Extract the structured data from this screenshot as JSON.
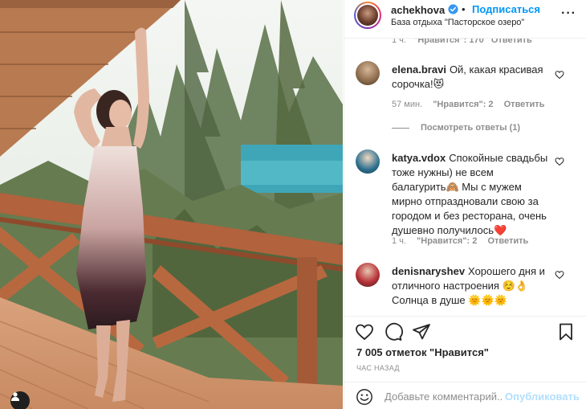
{
  "post": {
    "username": "achekhova",
    "follow_label": "Подписаться",
    "separator": "•",
    "location": "База отдыха \"Пасторское озеро\"",
    "more_glyph": "···"
  },
  "top_cut": {
    "time": "1 ч.",
    "likes": "\"Нравится\": 170",
    "reply": "Ответить"
  },
  "comments": [
    {
      "user": "elena.bravi",
      "text": "Ой, какая красивая сорочка!😻",
      "time": "57 мин.",
      "likes": "\"Нравится\": 2",
      "reply": "Ответить",
      "avatar_color": "#8a6a4a"
    },
    {
      "user": "katya.vdox",
      "text": "Спокойные свадьбы тоже нужны) не всем балагурить🙈 Мы с мужем мирно отпраздновали свою за городом и без ресторана, очень душевно получилось❤️",
      "time": "1 ч.",
      "likes": "\"Нравится\": 2",
      "reply": "Ответить",
      "avatar_color": "#2c6f8f"
    },
    {
      "user": "denisnaryshev",
      "text": "Хорошего дня и отличного настроения ☺️👌 Солнца в душе 🌞🌞🌞",
      "avatar_color": "#b8343a"
    }
  ],
  "view_replies": "Посмотреть ответы (1)",
  "likes_count": "7 005 отметок \"Нравится\"",
  "timestamp": "час назад",
  "comment_placeholder": "Добавьте комментарий...",
  "publish_label": "Опубликовать",
  "icons": [
    "verified-badge-icon",
    "more-options-icon",
    "heart-icon",
    "comment-icon",
    "share-icon",
    "bookmark-icon",
    "smile-icon",
    "user-tag-icon"
  ],
  "colors": {
    "accent": "#0095f6",
    "publish_disabled": "#b2dffc",
    "meta_text": "#8e8e8e",
    "text": "#262626",
    "border": "#efefef"
  }
}
